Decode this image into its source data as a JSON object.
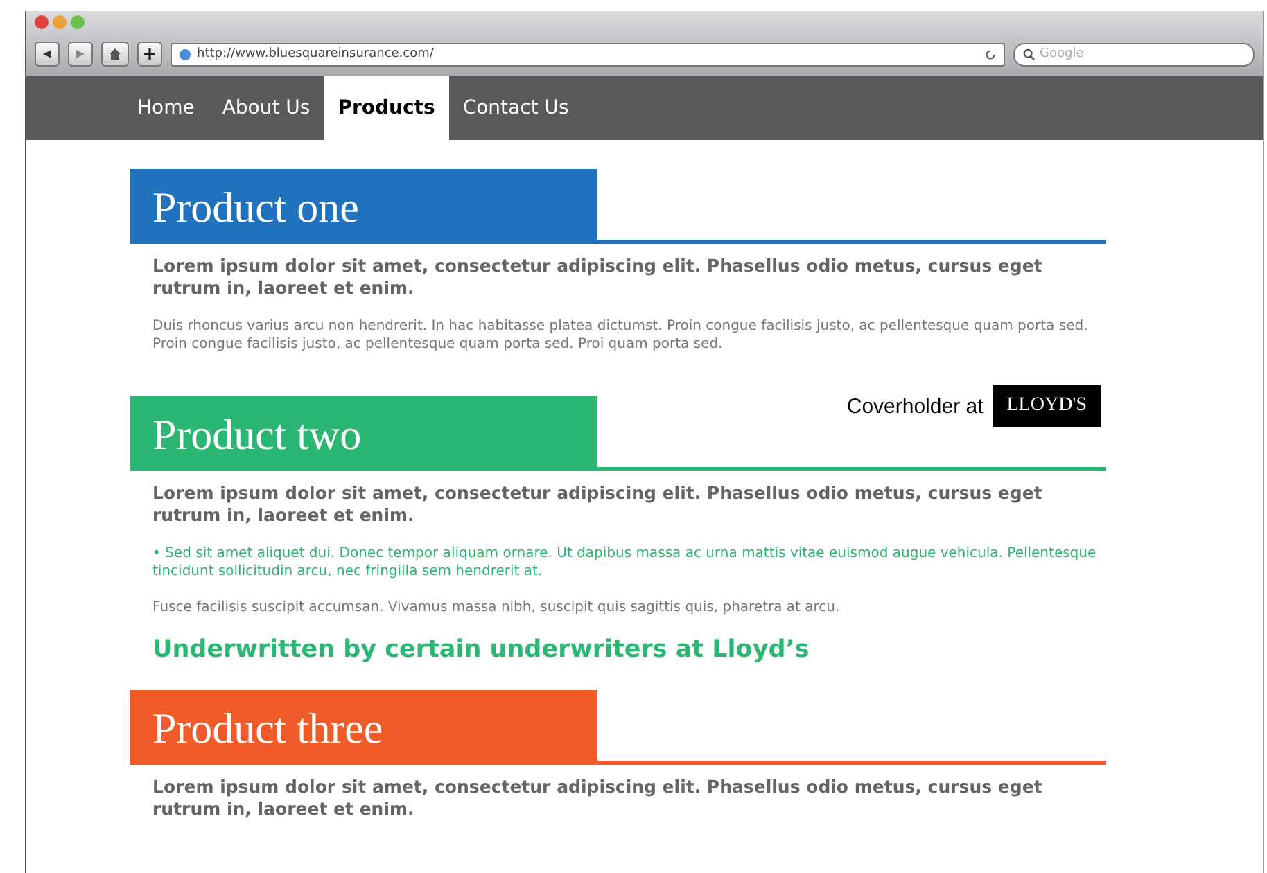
{
  "browser": {
    "url": "http://www.bluesquareinsurance.com/",
    "search": {
      "placeholder": "Google"
    }
  },
  "nav": [
    {
      "label": "Home",
      "selected": false
    },
    {
      "label": "About Us",
      "selected": false
    },
    {
      "label": "Products",
      "selected": true
    },
    {
      "label": "Contact Us",
      "selected": false
    }
  ],
  "sections": [
    {
      "title": "Product one",
      "color": "#1f72bb",
      "blocks": [
        {
          "kind": "lead",
          "text": "Lorem ipsum dolor sit amet, consectetur adipiscing elit. Phasellus odio metus, cursus eget rutrum in, laoreet et enim."
        },
        {
          "kind": "body",
          "text": "Duis rhoncus varius arcu non hendrerit. In hac habitasse platea dictumst. Proin congue facilisis justo, ac pellentesque quam porta sed. Proin congue facilisis justo, ac pellentesque quam porta sed. Proi quam porta sed."
        }
      ]
    },
    {
      "title": "Product two",
      "color": "#2bb673",
      "badge": {
        "label": "Coverholder at",
        "logo": "LLOYD'S"
      },
      "blocks": [
        {
          "kind": "lead",
          "text": "Lorem ipsum dolor sit amet, consectetur adipiscing elit. Phasellus odio metus, cursus eget rutrum in, laoreet et enim."
        },
        {
          "kind": "bullet",
          "text": "• Sed sit amet aliquet dui. Donec tempor aliquam ornare. Ut dapibus massa ac urna mattis vitae euismod augue vehicula. Pellentesque tincidunt sollicitudin arcu, nec fringilla sem hendrerit at."
        },
        {
          "kind": "body",
          "text": "Fusce facilisis suscipit accumsan. Vivamus massa nibh, suscipit quis sagittis quis, pharetra at arcu."
        },
        {
          "kind": "callout",
          "text": "Underwritten by certain underwriters at Lloyd’s"
        }
      ]
    },
    {
      "title": "Product three",
      "color": "#f15a29",
      "blocks": [
        {
          "kind": "lead",
          "text": "Lorem ipsum dolor sit amet, consectetur adipiscing elit. Phasellus odio metus, cursus eget rutrum in, laoreet et enim."
        }
      ]
    }
  ]
}
